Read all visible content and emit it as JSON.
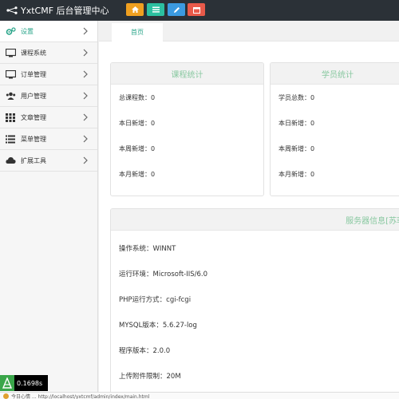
{
  "header": {
    "title": "YxtCMF 后台管理中心",
    "colors": {
      "bg": "#2b3137",
      "btn_orange": "#f0a020",
      "btn_teal": "#2cc0a0",
      "btn_blue": "#3b9ae0",
      "btn_red": "#e85a4a"
    },
    "buttons": [
      {
        "icon": "home-icon"
      },
      {
        "icon": "list-icon"
      },
      {
        "icon": "pencil-icon"
      },
      {
        "icon": "calendar-icon"
      }
    ]
  },
  "sidebar": {
    "accent": "#2aa58a",
    "items": [
      {
        "label": "设置",
        "icon": "gears-icon",
        "active": true
      },
      {
        "label": "课程系统",
        "icon": "monitor-icon"
      },
      {
        "label": "订单管理",
        "icon": "monitor-icon"
      },
      {
        "label": "用户管理",
        "icon": "users-icon"
      },
      {
        "label": "文章管理",
        "icon": "grid-icon"
      },
      {
        "label": "菜单管理",
        "icon": "list-icon"
      },
      {
        "label": "扩展工具",
        "icon": "cloud-icon"
      }
    ]
  },
  "tabs": [
    {
      "label": "首页",
      "active": true
    }
  ],
  "course_stats": {
    "title": "课程统计",
    "rows": [
      "总课程数：0",
      "本日新增：0",
      "本周新增：0",
      "本月新增：0"
    ]
  },
  "student_stats": {
    "title": "学员统计",
    "rows": [
      "学员总数：0",
      "本日新增：0",
      "本周新增：0",
      "本月新增：0"
    ]
  },
  "server_info": {
    "title": "服务器信息[苏菲",
    "rows": [
      "操作系统：WINNT",
      "运行环境：Microsoft-IIS/6.0",
      "PHP运行方式：cgi-fcgi",
      "MYSQL版本：5.6.27-log",
      "程序版本：2.0.0",
      "上传附件限制：20M"
    ]
  },
  "timer": {
    "value": "0.1698s"
  },
  "statusbar": {
    "text": "今日心情 ... http://localhost/yxtcmf/admin/index/main.html"
  }
}
